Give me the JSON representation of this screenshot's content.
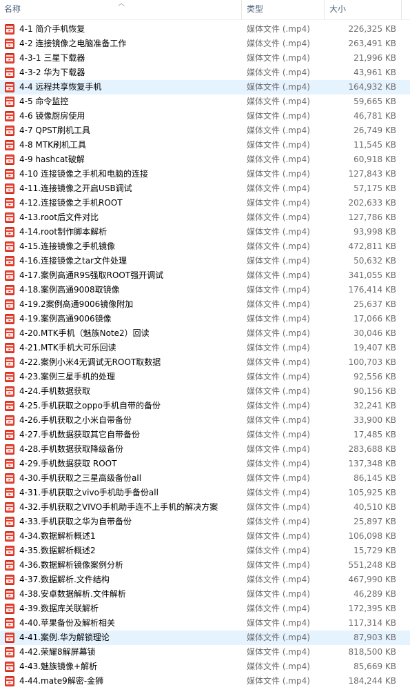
{
  "header": {
    "name": "名称",
    "type": "类型",
    "size": "大小"
  },
  "files": [
    {
      "name": "4-1 简介手机恢复",
      "type": "媒体文件 (.mp4)",
      "size": "226,325 KB",
      "selected": false
    },
    {
      "name": "4-2 连接镜像之电脑准备工作",
      "type": "媒体文件 (.mp4)",
      "size": "263,491 KB",
      "selected": false
    },
    {
      "name": "4-3-1 三星下载器",
      "type": "媒体文件 (.mp4)",
      "size": "21,996 KB",
      "selected": false
    },
    {
      "name": "4-3-2 华为下载器",
      "type": "媒体文件 (.mp4)",
      "size": "43,961 KB",
      "selected": false
    },
    {
      "name": "4-4 远程共享恢复手机",
      "type": "媒体文件 (.mp4)",
      "size": "164,932 KB",
      "selected": true
    },
    {
      "name": "4-5 命令监控",
      "type": "媒体文件 (.mp4)",
      "size": "59,665 KB",
      "selected": false
    },
    {
      "name": "4-6 镜像厨房使用",
      "type": "媒体文件 (.mp4)",
      "size": "46,781 KB",
      "selected": false
    },
    {
      "name": "4-7 QPST刷机工具",
      "type": "媒体文件 (.mp4)",
      "size": "26,749 KB",
      "selected": false
    },
    {
      "name": "4-8 MTK刷机工具",
      "type": "媒体文件 (.mp4)",
      "size": "11,545 KB",
      "selected": false
    },
    {
      "name": "4-9 hashcat破解",
      "type": "媒体文件 (.mp4)",
      "size": "60,918 KB",
      "selected": false
    },
    {
      "name": "4-10 连接镜像之手机和电脑的连接",
      "type": "媒体文件 (.mp4)",
      "size": "127,843 KB",
      "selected": false
    },
    {
      "name": "4-11.连接镜像之开启USB调试",
      "type": "媒体文件 (.mp4)",
      "size": "57,175 KB",
      "selected": false
    },
    {
      "name": "4-12.连接镜像之手机ROOT",
      "type": "媒体文件 (.mp4)",
      "size": "202,633 KB",
      "selected": false
    },
    {
      "name": "4-13.root后文件对比",
      "type": "媒体文件 (.mp4)",
      "size": "127,786 KB",
      "selected": false
    },
    {
      "name": "4-14.root制作脚本解析",
      "type": "媒体文件 (.mp4)",
      "size": "93,998 KB",
      "selected": false
    },
    {
      "name": "4-15.连接镜像之手机镜像",
      "type": "媒体文件 (.mp4)",
      "size": "472,811 KB",
      "selected": false
    },
    {
      "name": "4-16.连接镜像之tar文件处理",
      "type": "媒体文件 (.mp4)",
      "size": "50,632 KB",
      "selected": false
    },
    {
      "name": "4-17.案例高通R9S强取ROOT强开调试",
      "type": "媒体文件 (.mp4)",
      "size": "341,055 KB",
      "selected": false
    },
    {
      "name": "4-18.案例高通9008取镜像",
      "type": "媒体文件 (.mp4)",
      "size": "176,414 KB",
      "selected": false
    },
    {
      "name": "4-19.2案例高通9006镜像附加",
      "type": "媒体文件 (.mp4)",
      "size": "25,637 KB",
      "selected": false
    },
    {
      "name": "4-19.案例高通9006镜像",
      "type": "媒体文件 (.mp4)",
      "size": "17,066 KB",
      "selected": false
    },
    {
      "name": "4-20.MTK手机（魅族Note2）回读",
      "type": "媒体文件 (.mp4)",
      "size": "30,046 KB",
      "selected": false
    },
    {
      "name": "4-21.MTK手机大可乐回读",
      "type": "媒体文件 (.mp4)",
      "size": "19,407 KB",
      "selected": false
    },
    {
      "name": "4-22.案例小米4无调试无ROOT取数据",
      "type": "媒体文件 (.mp4)",
      "size": "100,703 KB",
      "selected": false
    },
    {
      "name": "4-23.案例三星手机的处理",
      "type": "媒体文件 (.mp4)",
      "size": "92,556 KB",
      "selected": false
    },
    {
      "name": "4-24.手机数据获取",
      "type": "媒体文件 (.mp4)",
      "size": "90,156 KB",
      "selected": false
    },
    {
      "name": "4-25.手机获取之oppo手机自带的备份",
      "type": "媒体文件 (.mp4)",
      "size": "32,241 KB",
      "selected": false
    },
    {
      "name": "4-26.手机获取之小米自带备份",
      "type": "媒体文件 (.mp4)",
      "size": "33,900 KB",
      "selected": false
    },
    {
      "name": "4-27.手机数据获取其它自带备份",
      "type": "媒体文件 (.mp4)",
      "size": "17,485 KB",
      "selected": false
    },
    {
      "name": "4-28.手机数据获取降级备份",
      "type": "媒体文件 (.mp4)",
      "size": "283,688 KB",
      "selected": false
    },
    {
      "name": "4-29.手机数据获取 ROOT",
      "type": "媒体文件 (.mp4)",
      "size": "137,348 KB",
      "selected": false
    },
    {
      "name": "4-30.手机获取之三星高级备份all",
      "type": "媒体文件 (.mp4)",
      "size": "86,145 KB",
      "selected": false
    },
    {
      "name": "4-31.手机获取之vivo手机助手备份all",
      "type": "媒体文件 (.mp4)",
      "size": "105,925 KB",
      "selected": false
    },
    {
      "name": "4-32.手机获取之VIVO手机助手连不上手机的解决方案",
      "type": "媒体文件 (.mp4)",
      "size": "40,510 KB",
      "selected": false
    },
    {
      "name": "4-33.手机获取之华为自带备份",
      "type": "媒体文件 (.mp4)",
      "size": "25,897 KB",
      "selected": false
    },
    {
      "name": "4-34.数据解析概述1",
      "type": "媒体文件 (.mp4)",
      "size": "106,098 KB",
      "selected": false
    },
    {
      "name": "4-35.数据解析概述2",
      "type": "媒体文件 (.mp4)",
      "size": "15,729 KB",
      "selected": false
    },
    {
      "name": "4-36.数据解析镜像案例分析",
      "type": "媒体文件 (.mp4)",
      "size": "551,248 KB",
      "selected": false
    },
    {
      "name": "4-37.数据解析.文件结构",
      "type": "媒体文件 (.mp4)",
      "size": "467,990 KB",
      "selected": false
    },
    {
      "name": "4-38.安卓数据解析.文件解析",
      "type": "媒体文件 (.mp4)",
      "size": "46,289 KB",
      "selected": false
    },
    {
      "name": "4-39.数据库关联解析",
      "type": "媒体文件 (.mp4)",
      "size": "172,395 KB",
      "selected": false
    },
    {
      "name": "4-40.苹果备份及解析相关",
      "type": "媒体文件 (.mp4)",
      "size": "117,314 KB",
      "selected": false
    },
    {
      "name": "4-41.案例.华为解锁理论",
      "type": "媒体文件 (.mp4)",
      "size": "87,903 KB",
      "selected": true
    },
    {
      "name": "4-42.荣耀8解屏幕锁",
      "type": "媒体文件 (.mp4)",
      "size": "818,500 KB",
      "selected": false
    },
    {
      "name": "4-43.魅族镜像+解析",
      "type": "媒体文件 (.mp4)",
      "size": "85,669 KB",
      "selected": false
    },
    {
      "name": "4-44.mate9解密-金狮",
      "type": "媒体文件 (.mp4)",
      "size": "184,244 KB",
      "selected": false
    }
  ],
  "colors": {
    "icon_red": "#e8402f",
    "selected_row": "#e5f3ff",
    "header_text": "#4c607a"
  },
  "icon": "mp4-file-icon"
}
